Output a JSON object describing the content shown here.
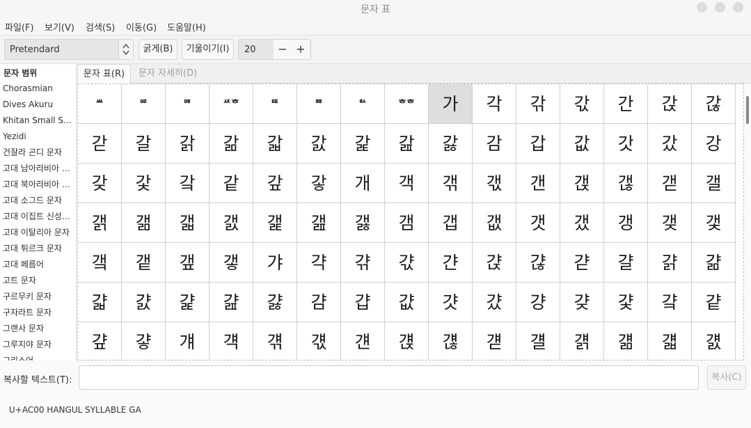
{
  "window": {
    "title": "문자 표"
  },
  "menu": {
    "items": [
      "파일(F)",
      "보기(V)",
      "검색(S)",
      "이동(G)",
      "도움말(H)"
    ]
  },
  "toolbar": {
    "font_name": "Pretendard",
    "bold_label": "굵게(B)",
    "italic_label": "기울이기(I)",
    "font_size": "20",
    "minus_label": "−",
    "plus_label": "+"
  },
  "sidebar": {
    "heading": "문자 범위",
    "items": [
      "Chorasmian",
      "Dives Akuru",
      "Khitan Small Script",
      "Yezidi",
      "건잘라 곤디 문자",
      "고대 남아라비아 문자",
      "고대 북아라비아 문자",
      "고대 소그드 문자",
      "고대 이집트 신성문자",
      "고대 이탈리아 문자",
      "고대 튀르크 문자",
      "고대 페름어",
      "고트 문자",
      "구르무키 문자",
      "구자라트 문자",
      "그랜사 문자",
      "그루지야 문자",
      "그리스어"
    ]
  },
  "tabs": [
    {
      "label": "문자 표(R)",
      "active": true
    },
    {
      "label": "문자 자세히(D)",
      "active": false
    }
  ],
  "grid": {
    "selected_char": "가",
    "rows": [
      [
        "ᄴ",
        "ᄋᄅ",
        "ᄋᄒ",
        "ᄶᄒ",
        "ᄐᄐ",
        "ᄑᄒ",
        "ᄒᄉ",
        "ᄒᄒ",
        "가",
        "각",
        "갂",
        "갃",
        "간",
        "갅",
        "갆"
      ],
      [
        "갇",
        "갈",
        "갉",
        "갊",
        "갋",
        "갌",
        "갍",
        "갎",
        "갏",
        "감",
        "갑",
        "값",
        "갓",
        "갔",
        "강"
      ],
      [
        "갖",
        "갗",
        "갘",
        "같",
        "갚",
        "갛",
        "개",
        "객",
        "갞",
        "갟",
        "갠",
        "갡",
        "갢",
        "갣",
        "갤"
      ],
      [
        "갥",
        "갦",
        "갧",
        "갨",
        "갩",
        "갪",
        "갫",
        "갬",
        "갭",
        "갮",
        "갯",
        "갰",
        "갱",
        "갲",
        "갳"
      ],
      [
        "갴",
        "갵",
        "갶",
        "갷",
        "갸",
        "갹",
        "갺",
        "갻",
        "갼",
        "갽",
        "갾",
        "갿",
        "걀",
        "걁",
        "걂"
      ],
      [
        "걃",
        "걄",
        "걅",
        "걆",
        "걇",
        "걈",
        "걉",
        "걊",
        "걋",
        "걌",
        "걍",
        "걎",
        "걏",
        "걐",
        "걑"
      ],
      [
        "걒",
        "걓",
        "걔",
        "걕",
        "걖",
        "걗",
        "걘",
        "걙",
        "걚",
        "걛",
        "걜",
        "걝",
        "걞",
        "걟",
        "걠"
      ]
    ]
  },
  "copy": {
    "label": "복사할 텍스트(T):",
    "value": "",
    "button_label": "복사(C)"
  },
  "status": {
    "text": "U+AC00 HANGUL SYLLABLE GA"
  }
}
